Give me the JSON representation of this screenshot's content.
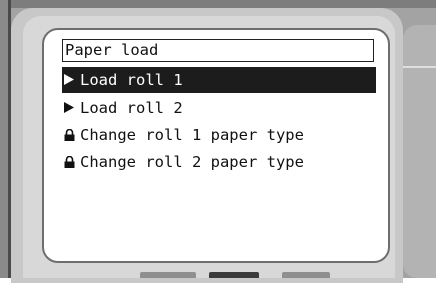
{
  "panel": {
    "title": "Paper load",
    "menu_items": [
      {
        "label": "Load roll 1",
        "icon": "arrow-right-icon",
        "selected": true
      },
      {
        "label": "Load roll 2",
        "icon": "arrow-right-icon",
        "selected": false
      },
      {
        "label": "Change roll 1 paper type",
        "icon": "lock-icon",
        "selected": false
      },
      {
        "label": "Change roll 2 paper type",
        "icon": "lock-icon",
        "selected": false
      }
    ]
  },
  "colors": {
    "bezel": "#a3a3a3",
    "screen_background": "#ffffff",
    "highlight": "#1c1c1c",
    "text": "#111111"
  }
}
